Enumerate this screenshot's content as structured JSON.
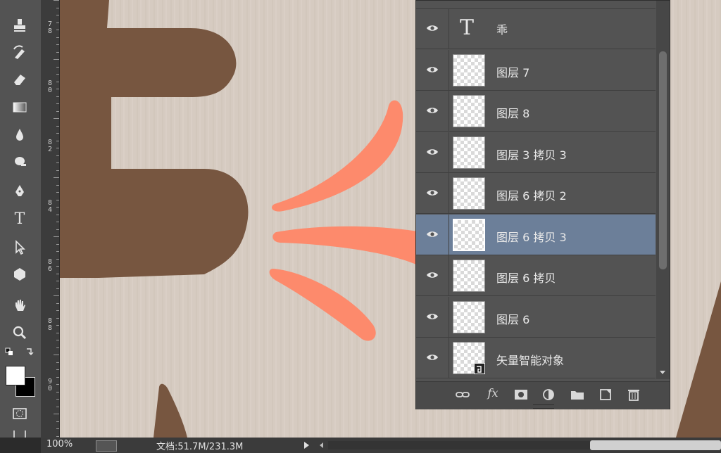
{
  "status": {
    "zoom": "100%",
    "doc_info": "文档:51.7M/231.3M"
  },
  "ruler": {
    "labels": [
      "7\n8",
      "8\n0",
      "8\n2",
      "8\n4",
      "8\n6",
      "8\n8",
      "9\n0"
    ]
  },
  "layers": [
    {
      "name": "乖",
      "type": "text",
      "selected": false
    },
    {
      "name": "图层 7",
      "type": "raster",
      "selected": false
    },
    {
      "name": "图层 8",
      "type": "raster",
      "selected": false
    },
    {
      "name": "图层 3 拷贝 3",
      "type": "raster",
      "selected": false
    },
    {
      "name": "图层 6 拷贝 2",
      "type": "raster",
      "selected": false
    },
    {
      "name": "图层 6 拷贝 3",
      "type": "raster",
      "selected": true
    },
    {
      "name": "图层 6 拷贝",
      "type": "raster",
      "selected": false
    },
    {
      "name": "图层 6",
      "type": "raster",
      "selected": false
    },
    {
      "name": "矢量智能对象",
      "type": "smart",
      "selected": false
    }
  ],
  "panel_footer": {
    "fx_label": "fx"
  },
  "colors": {
    "brown": "#775640",
    "orange": "#fd8a6c",
    "canvas_bg": "#d6cbc1",
    "selected_row": "#6c7f99"
  }
}
